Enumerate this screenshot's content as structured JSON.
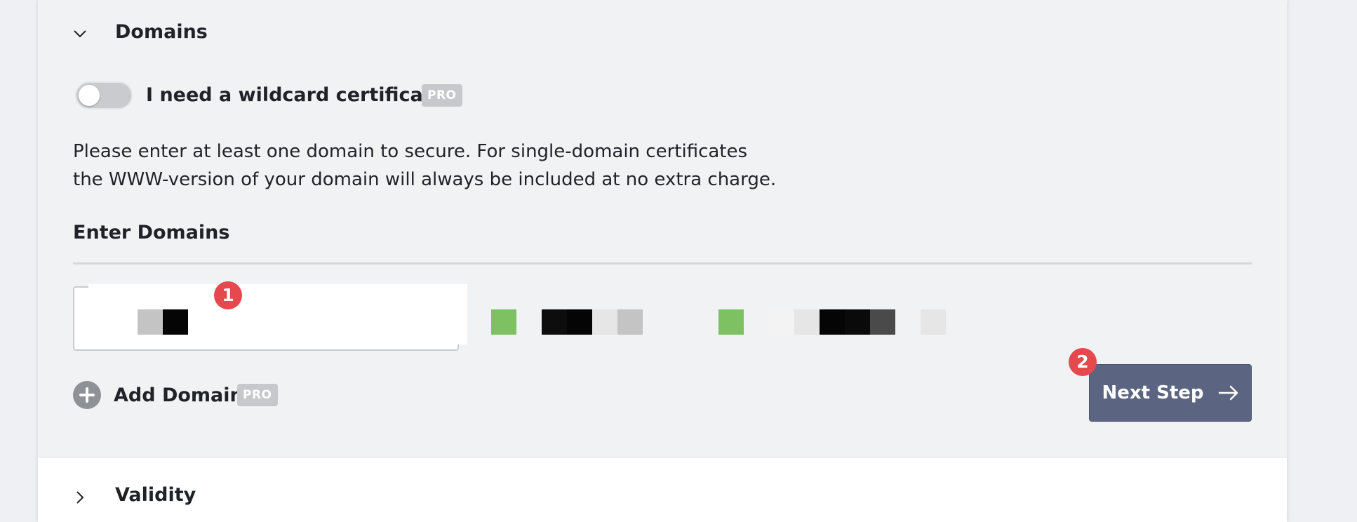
{
  "domains_section": {
    "title": "Domains",
    "wildcard_label": "I need a wildcard certificate",
    "pro_badge": "PRO",
    "info_line1": "Please enter at least one domain to secure. For single-domain certificates",
    "info_line2": "the WWW-version of your domain will always be included at no extra charge.",
    "enter_domains_label": "Enter Domains",
    "domain_input_value": "",
    "add_domain_label": "Add Domain",
    "add_domain_badge": "PRO",
    "next_button_label": "Next Step",
    "step_badge_1": "1",
    "step_badge_2": "2"
  },
  "validity_section": {
    "title": "Validity"
  },
  "colors": {
    "accent_button": "#5b6581",
    "step_badge": "#e5484d",
    "pro_badge": "#c6c8cb",
    "pixel_green": "#7dc162"
  },
  "icons": {
    "domains_chevron": "chevron-down-icon",
    "validity_chevron": "chevron-right-icon",
    "add": "plus-circle-icon",
    "next": "arrow-right-icon"
  }
}
